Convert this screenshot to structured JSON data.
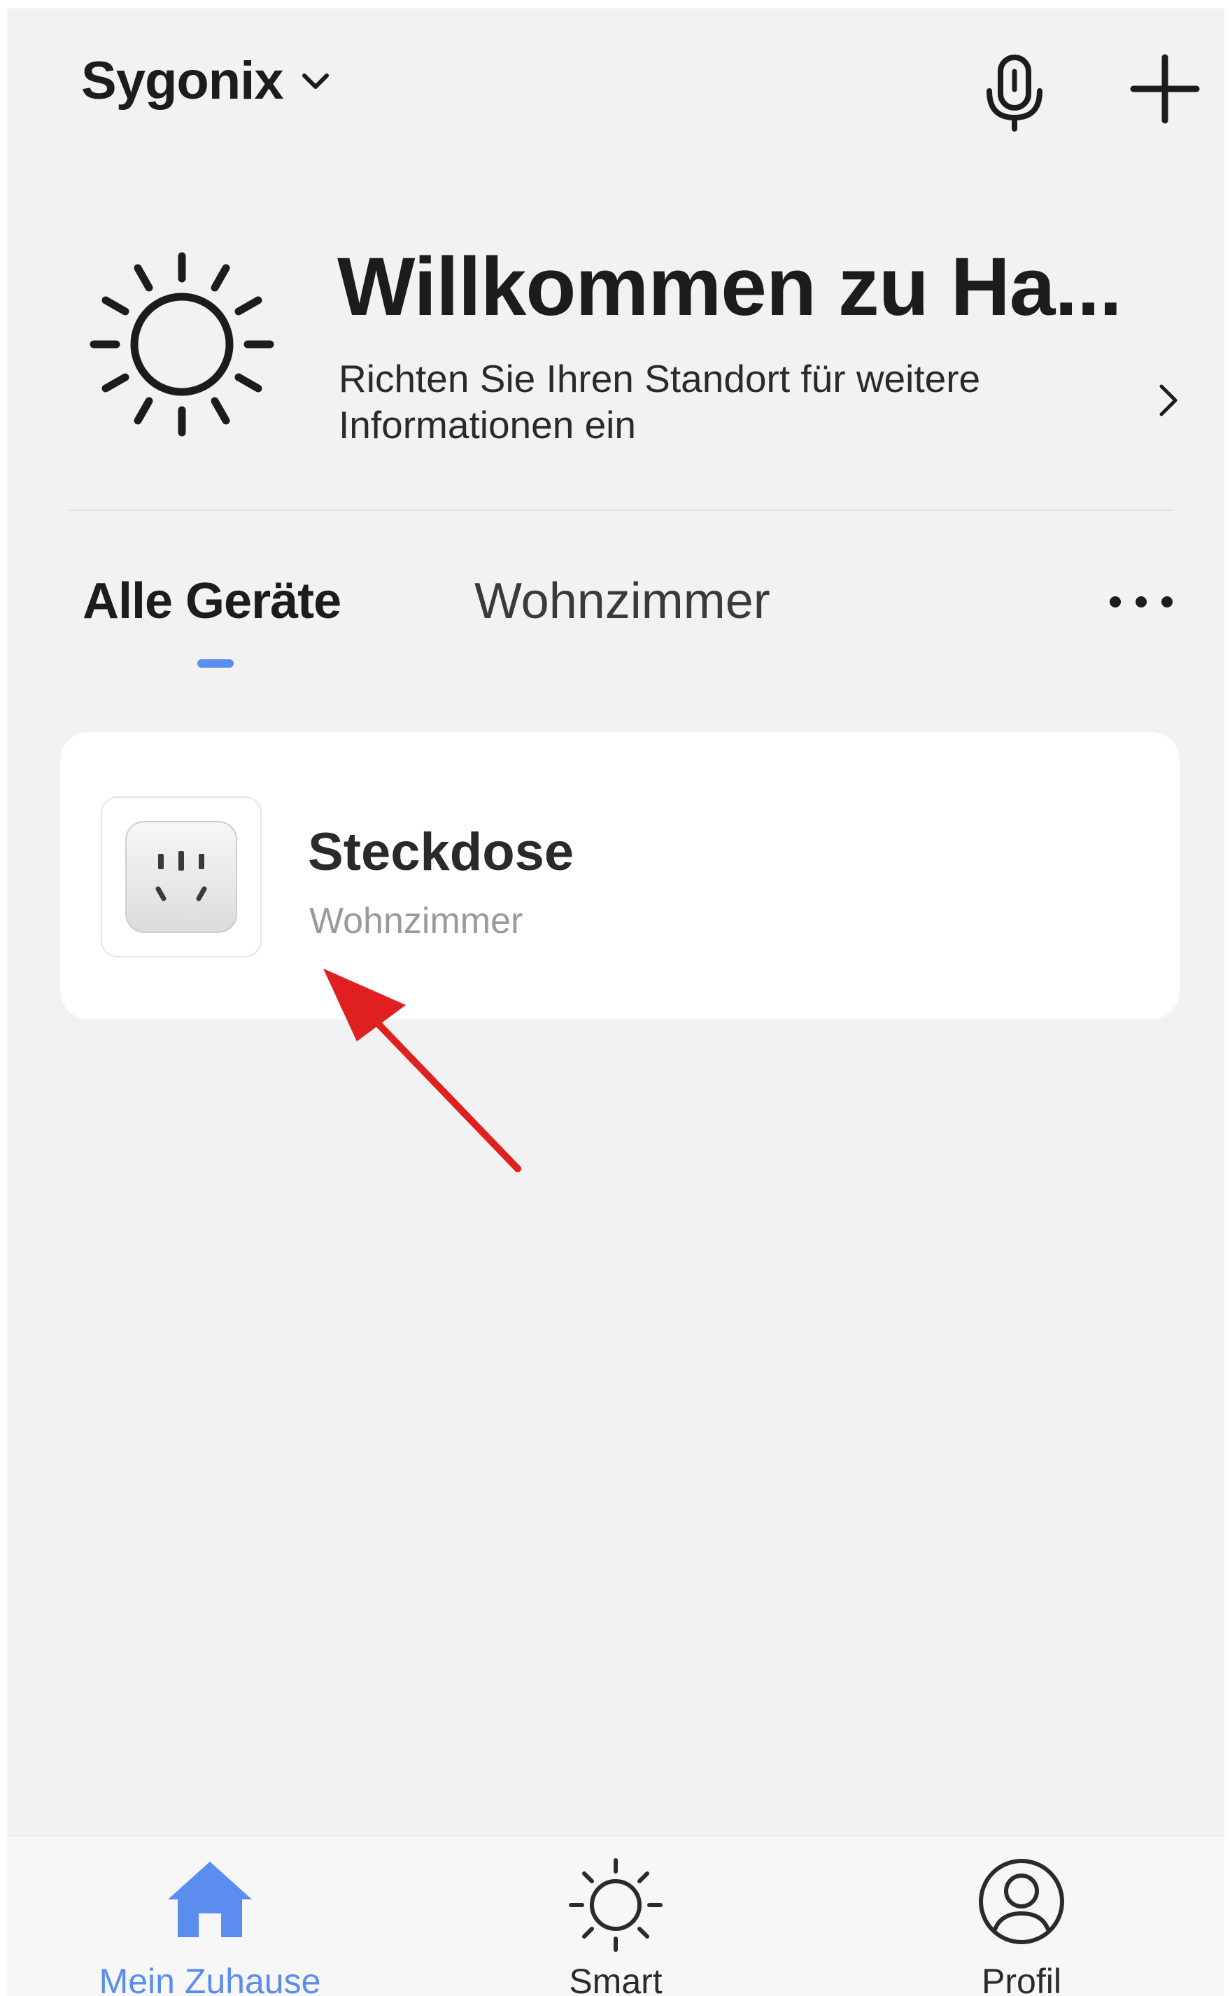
{
  "header": {
    "home_name": "Sygonix",
    "icons": [
      "chevron-down-icon",
      "microphone-icon",
      "plus-icon"
    ]
  },
  "welcome": {
    "title": "Willkommen zu Ha...",
    "subtitle": "Richten Sie Ihren Standort für weitere Informationen ein",
    "icon": "sun-icon"
  },
  "tabs": [
    {
      "label": "Alle Geräte",
      "active": true
    },
    {
      "label": "Wohnzimmer",
      "active": false
    }
  ],
  "devices": [
    {
      "name": "Steckdose",
      "room": "Wohnzimmer",
      "icon": "power-socket-icon"
    }
  ],
  "bottom_nav": [
    {
      "label": "Mein Zuhause",
      "icon": "home-icon",
      "active": true
    },
    {
      "label": "Smart",
      "icon": "sun-icon",
      "active": false
    },
    {
      "label": "Profil",
      "icon": "profile-icon",
      "active": false
    }
  ],
  "colors": {
    "background": "#f2f2f2",
    "accent": "#5b8def",
    "annotation_arrow": "#e02020",
    "text_primary": "#1c1c1e",
    "text_secondary": "#9a9a9a"
  }
}
